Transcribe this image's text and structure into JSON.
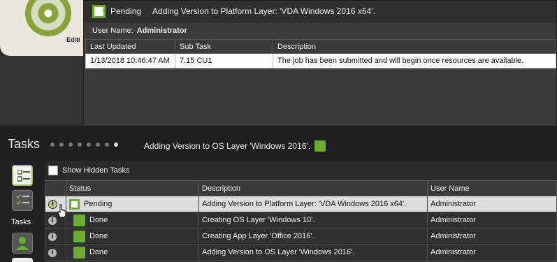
{
  "background": {
    "edition_text": "Editi"
  },
  "popup": {
    "status": "Pending",
    "title": "Adding Version to Platform Layer: 'VDA Windows 2016 x64'.",
    "user_label": "User Name:",
    "user_value": "Administrator",
    "columns": [
      "Last Updated",
      "Sub Task",
      "Description"
    ],
    "rows": [
      {
        "updated": "1/13/2018 10:46:47 AM",
        "subtask": "7.15 CU1",
        "description": "The job has been submitted and will begin once resources are available."
      }
    ]
  },
  "tasks": {
    "title": "Tasks",
    "page_dots": 8,
    "active_dot": 8,
    "message": "Adding Version to OS Layer 'Windows 2016'.",
    "show_hidden_label": "Show Hidden Tasks",
    "columns": [
      "",
      "Status",
      "Description",
      "User Name"
    ],
    "rows": [
      {
        "status": "Pending",
        "description": "Adding Version to Platform Layer: 'VDA Windows 2016 x64'.",
        "user": "Administrator",
        "selected": true
      },
      {
        "status": "Done",
        "description": "Creating OS Layer 'Windows 10'.",
        "user": "Administrator",
        "selected": false
      },
      {
        "status": "Done",
        "description": "Creating App Layer 'Office 2016'.",
        "user": "Administrator",
        "selected": false
      },
      {
        "status": "Done",
        "description": "Adding Version to OS Layer 'Windows 2016'.",
        "user": "Administrator",
        "selected": false
      }
    ]
  },
  "nav": {
    "tasks_label": "Tasks"
  },
  "icons": {
    "info": "info-icon",
    "pending": "pending-status-icon",
    "done": "done-status-icon",
    "cursor": "hand-cursor-icon"
  },
  "colors": {
    "accent_green": "#6aac2d",
    "selected_row": "#dcdcdc"
  }
}
